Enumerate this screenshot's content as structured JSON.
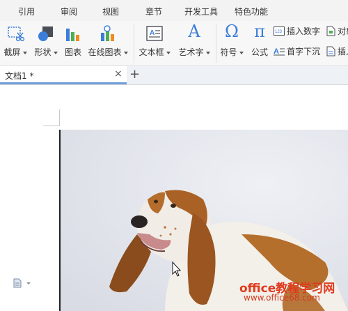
{
  "menu": {
    "tabs": [
      "引用",
      "审阅",
      "视图",
      "章节",
      "开发工具",
      "特色功能"
    ]
  },
  "ribbon": {
    "screenshot_label": "截屏",
    "shape_label": "形状",
    "chart_label": "图表",
    "online_chart_label": "在线图表",
    "textbox_label": "文本框",
    "wordart_label": "艺术字",
    "symbol_label": "符号",
    "formula_label": "公式",
    "insert_number_label": "插入数字",
    "object_label": "对象",
    "dropcap_label": "首字下沉",
    "insert_label": "插入"
  },
  "doc_tabs": {
    "active_name": "文档1 *",
    "close_glyph": "×",
    "new_tab_glyph": "+"
  },
  "watermark": {
    "line1": "office教程学习网",
    "line2": "www.office68.com"
  },
  "icons": {
    "formula_glyph": "π",
    "symbol_glyph": "Ω",
    "wordart_glyph": "A",
    "number_badge": "123"
  },
  "colors": {
    "accent_blue": "#3b7dd8",
    "chart_green": "#4caf50",
    "chart_orange": "#f08a24",
    "watermark_red": "#e03a1e"
  }
}
